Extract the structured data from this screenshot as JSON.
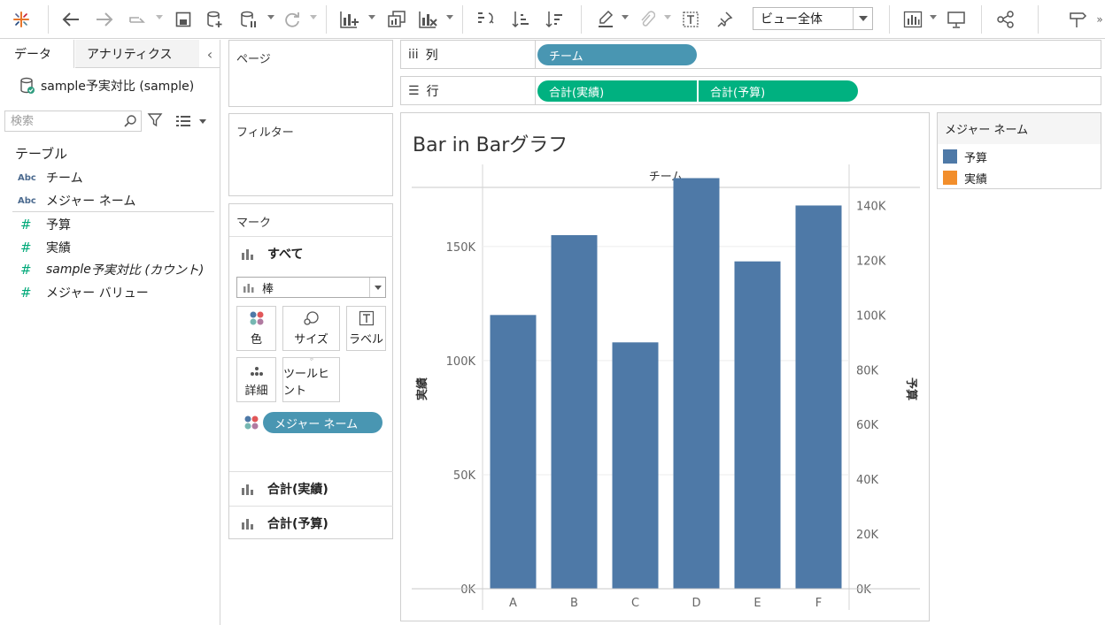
{
  "toolbar": {
    "view_mode": "ビュー全体"
  },
  "data_pane": {
    "tab_data": "データ",
    "tab_analytics": "アナリティクス",
    "datasource": "sample予実対比 (sample)",
    "search_placeholder": "検索",
    "section_title": "テーブル",
    "fields": [
      {
        "type": "Abc",
        "name": "チーム"
      },
      {
        "type": "Abc",
        "name": "メジャー ネーム"
      },
      {
        "type": "#",
        "name": "予算"
      },
      {
        "type": "#",
        "name": "実績"
      },
      {
        "type": "#",
        "name_italic": "sample",
        "name": "予実対比 (カウント)"
      },
      {
        "type": "#",
        "name": "メジャー バリュー"
      }
    ]
  },
  "pages_card": {
    "title": "ページ"
  },
  "filters_card": {
    "title": "フィルター"
  },
  "marks_card": {
    "title": "マーク",
    "all": "すべて",
    "mark_type": "棒",
    "color": "色",
    "size": "サイズ",
    "label": "ラベル",
    "detail": "詳細",
    "tooltip": "ツールヒント",
    "color_pill": "メジャー ネーム",
    "measure1": "合計(実績)",
    "measure2": "合計(予算)"
  },
  "shelves": {
    "columns_label": "列",
    "rows_label": "行",
    "columns_pill": "チーム",
    "rows_pills": [
      "合計(実績)",
      "合計(予算)"
    ]
  },
  "legend": {
    "title": "メジャー ネーム",
    "items": [
      {
        "name": "予算",
        "color": "#4e79a7"
      },
      {
        "name": "実績",
        "color": "#f28e2b"
      }
    ]
  },
  "chart_data": {
    "type": "bar",
    "title": "Bar in Barグラフ",
    "column_header": "チーム",
    "categories": [
      "A",
      "B",
      "C",
      "D",
      "E",
      "F"
    ],
    "series": [
      {
        "name": "実績",
        "color": "#4e79a7",
        "axis": "left",
        "values": [
          120000,
          155000,
          108000,
          180000,
          143500,
          168000
        ]
      },
      {
        "name": "予算",
        "color": "#f28e2b",
        "axis": "right",
        "values": []
      }
    ],
    "left_axis": {
      "label": "実績",
      "ticks": [
        "0K",
        "50K",
        "100K",
        "150K"
      ],
      "tick_values": [
        0,
        50000,
        100000,
        150000
      ],
      "max": 186000
    },
    "right_axis": {
      "label": "予算",
      "ticks": [
        "0K",
        "20K",
        "40K",
        "60K",
        "80K",
        "100K",
        "120K",
        "140K"
      ],
      "tick_values": [
        0,
        20000,
        40000,
        60000,
        80000,
        100000,
        120000,
        140000
      ],
      "max": 155000
    },
    "grid": true
  }
}
